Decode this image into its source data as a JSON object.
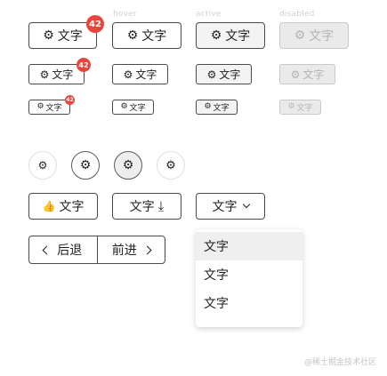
{
  "states": {
    "hover": "hover",
    "active": "active",
    "disabled": "disabled"
  },
  "button": {
    "label": "文字",
    "icon": "gear-icon",
    "icon_glyph": "⚙",
    "badge": "42"
  },
  "circle_icon_glyph": "⚙",
  "thumb": {
    "icon": "thumb-up-icon",
    "icon_glyph": "👍",
    "label": "文字"
  },
  "download": {
    "label": "文字",
    "icon": "download-icon",
    "icon_glyph": "⤓"
  },
  "dropdown": {
    "label": "文字",
    "icon": "chevron-down-icon",
    "items": [
      "文字",
      "文字",
      "文字"
    ],
    "highlighted_index": 0
  },
  "nav_group": {
    "back": "后退",
    "forward": "前进",
    "back_icon": "chevron-left-icon",
    "forward_icon": "chevron-right-icon"
  },
  "watermark": "@稀土掘金技术社区",
  "colors": {
    "badge": "#e8453c",
    "border": "#4a4a4a",
    "disabled_bg": "#eaeaea",
    "menu_highlight": "#efefef"
  }
}
